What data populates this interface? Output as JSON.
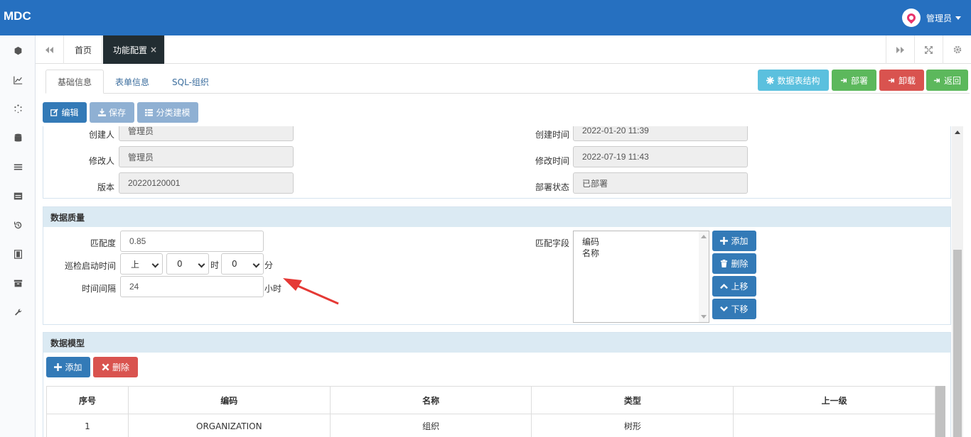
{
  "app": {
    "logo": "MDC",
    "user_name": "管理员"
  },
  "tabs": {
    "home": "首页",
    "active": "功能配置",
    "close": "×"
  },
  "subtabs": [
    "基础信息",
    "表单信息",
    "SQL-组织"
  ],
  "top_actions": {
    "structure": "数据表结构",
    "deploy": "部署",
    "undeploy": "卸载",
    "back": "返回"
  },
  "toolbar": {
    "edit": "编辑",
    "save": "保存",
    "classify": "分类建模"
  },
  "basic": {
    "creator_label": "创建人",
    "creator": "管理员",
    "modifier_label": "修改人",
    "modifier": "管理员",
    "version_label": "版本",
    "version": "20220120001",
    "created_label": "创建时间",
    "created": "2022-01-20 11:39",
    "modified_label": "修改时间",
    "modified": "2022-07-19 11:43",
    "deploy_label": "部署状态",
    "deploy_status": "已部署"
  },
  "quality": {
    "title": "数据质量",
    "match_label": "匹配度",
    "match": "0.85",
    "inspect_label": "巡检启动时间",
    "ampm": "上",
    "hour": "0",
    "hour_unit": "时",
    "minute": "0",
    "minute_unit": "分",
    "interval_label": "时间间隔",
    "interval": "24",
    "interval_unit": "小时",
    "fields_label": "匹配字段",
    "fields": [
      "编码",
      "名称"
    ],
    "add": "添加",
    "delete": "删除",
    "up": "上移",
    "down": "下移"
  },
  "model": {
    "title": "数据模型",
    "add": "添加",
    "delete": "删除",
    "columns": [
      "序号",
      "编码",
      "名称",
      "类型",
      "上一级"
    ],
    "rows": [
      [
        "1",
        "ORGANIZATION",
        "组织",
        "树形",
        ""
      ]
    ]
  },
  "colors": {
    "header": "#2670c0",
    "primary": "#337ab7",
    "success": "#5cb85c",
    "danger": "#d9534f",
    "info": "#5bc0de",
    "annotation_arrow": "#e53935"
  }
}
